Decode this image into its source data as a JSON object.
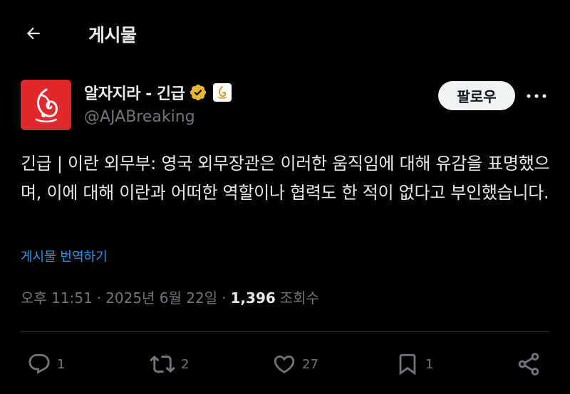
{
  "header": {
    "title": "게시물",
    "back_icon": "arrow-left-icon"
  },
  "author": {
    "display_name": "알자지라 - 긴급",
    "handle": "@AJABreaking",
    "verified_color": "#e8b829",
    "avatar_color": "#e1282c"
  },
  "follow_label": "팔로우",
  "tweet": {
    "text": "긴급 | 이란 외무부: 영국 외무장관은 이러한 움직임에 대해 유감을 표명했으며, 이에 대해 이란과 어떠한 역할이나 협력도 한 적이 없다고 부인했습니다.",
    "translate_label": "게시물 번역하기"
  },
  "meta": {
    "time": "오후 11:51",
    "date": "2025년 6월 22일",
    "views": "1,396",
    "views_label": "조회수"
  },
  "actions": {
    "replies": "1",
    "reposts": "2",
    "likes": "27",
    "bookmarks": "1"
  },
  "colors": {
    "background": "#000000",
    "text": "#e7e9ea",
    "muted": "#71767b",
    "link": "#1d9bf0"
  }
}
